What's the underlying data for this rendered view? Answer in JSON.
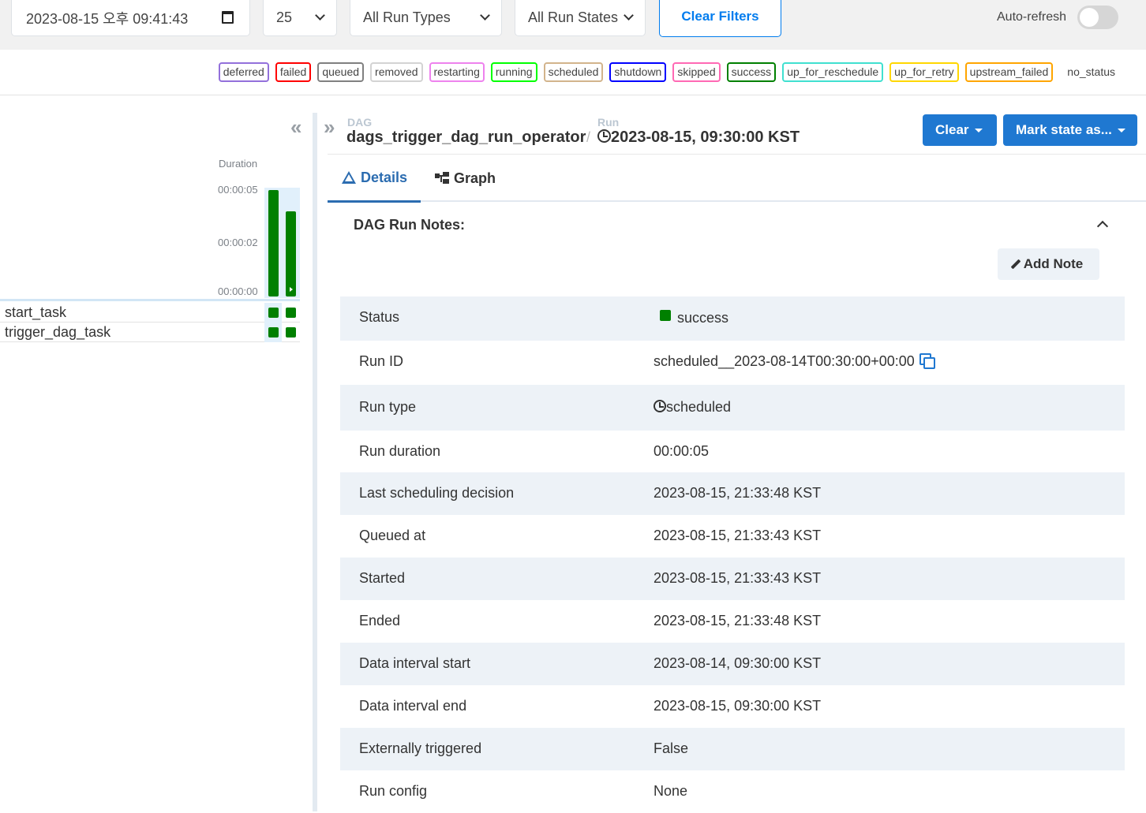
{
  "filters": {
    "base_date": "2023-08-15 오후 09:41:43",
    "num_runs": "25",
    "run_types": "All Run Types",
    "run_states": "All Run States",
    "clear_filters": "Clear Filters",
    "auto_refresh": "Auto-refresh"
  },
  "legend": [
    {
      "label": "deferred",
      "color": "#9370db"
    },
    {
      "label": "failed",
      "color": "#ff0000"
    },
    {
      "label": "queued",
      "color": "#808080"
    },
    {
      "label": "removed",
      "color": "#d3d3d3"
    },
    {
      "label": "restarting",
      "color": "#ee82ee"
    },
    {
      "label": "running",
      "color": "#00ff00"
    },
    {
      "label": "scheduled",
      "color": "#d2b48c"
    },
    {
      "label": "shutdown",
      "color": "#0000ff"
    },
    {
      "label": "skipped",
      "color": "#ff69b4"
    },
    {
      "label": "success",
      "color": "#008000"
    },
    {
      "label": "up_for_reschedule",
      "color": "#40e0d0"
    },
    {
      "label": "up_for_retry",
      "color": "#ffd700"
    },
    {
      "label": "upstream_failed",
      "color": "#ffa500"
    },
    {
      "label": "no_status",
      "color": "transparent"
    }
  ],
  "grid": {
    "duration_label": "Duration",
    "ticks": [
      "00:00:05",
      "00:00:02",
      "00:00:00"
    ],
    "run_durations_sec": [
      5,
      4
    ],
    "success_color": "#008000",
    "tasks": [
      "start_task",
      "trigger_dag_task"
    ]
  },
  "breadcrumb": {
    "dag_label": "DAG",
    "dag_id": "dags_trigger_dag_run_operator",
    "run_label": "Run",
    "run_date": "2023-08-15, 09:30:00 KST"
  },
  "actions": {
    "clear": "Clear",
    "mark_state": "Mark state as..."
  },
  "tabs": {
    "details": "Details",
    "graph": "Graph"
  },
  "notes": {
    "title": "DAG Run Notes:",
    "add_note": "Add Note"
  },
  "details": {
    "status": {
      "label": "Status",
      "value": "success"
    },
    "run_id": {
      "label": "Run ID",
      "value": "scheduled__2023-08-14T00:30:00+00:00"
    },
    "run_type": {
      "label": "Run type",
      "value": "scheduled"
    },
    "run_duration": {
      "label": "Run duration",
      "value": "00:00:05"
    },
    "last_scheduling": {
      "label": "Last scheduling decision",
      "value": "2023-08-15, 21:33:48 KST"
    },
    "queued_at": {
      "label": "Queued at",
      "value": "2023-08-15, 21:33:43 KST"
    },
    "started": {
      "label": "Started",
      "value": "2023-08-15, 21:33:43 KST"
    },
    "ended": {
      "label": "Ended",
      "value": "2023-08-15, 21:33:48 KST"
    },
    "interval_start": {
      "label": "Data interval start",
      "value": "2023-08-14, 09:30:00 KST"
    },
    "interval_end": {
      "label": "Data interval end",
      "value": "2023-08-15, 09:30:00 KST"
    },
    "externally_triggered": {
      "label": "Externally triggered",
      "value": "False"
    },
    "run_config": {
      "label": "Run config",
      "value": "None"
    }
  }
}
